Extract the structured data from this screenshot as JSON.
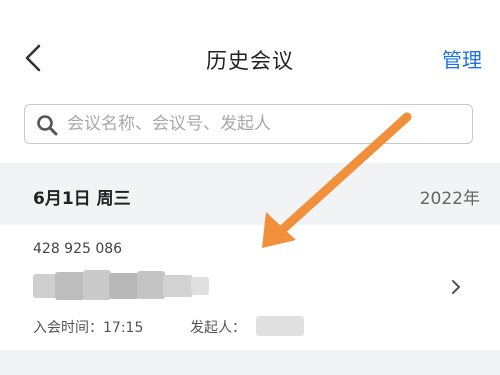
{
  "header": {
    "title": "历史会议",
    "manage_label": "管理",
    "back_icon": "chevron-left-icon"
  },
  "search": {
    "placeholder": "会议名称、会议号、发起人",
    "value": "",
    "icon": "search-icon"
  },
  "date_group": {
    "date": "6月1日 周三",
    "year": "2022年"
  },
  "meeting": {
    "id": "428 925 086",
    "join_time_label": "入会时间：17:15",
    "initiator_label": "发起人："
  },
  "colors": {
    "accent": "#1e73e8",
    "annotation_arrow": "#f0903a",
    "group_background": "#f2f3f5"
  }
}
